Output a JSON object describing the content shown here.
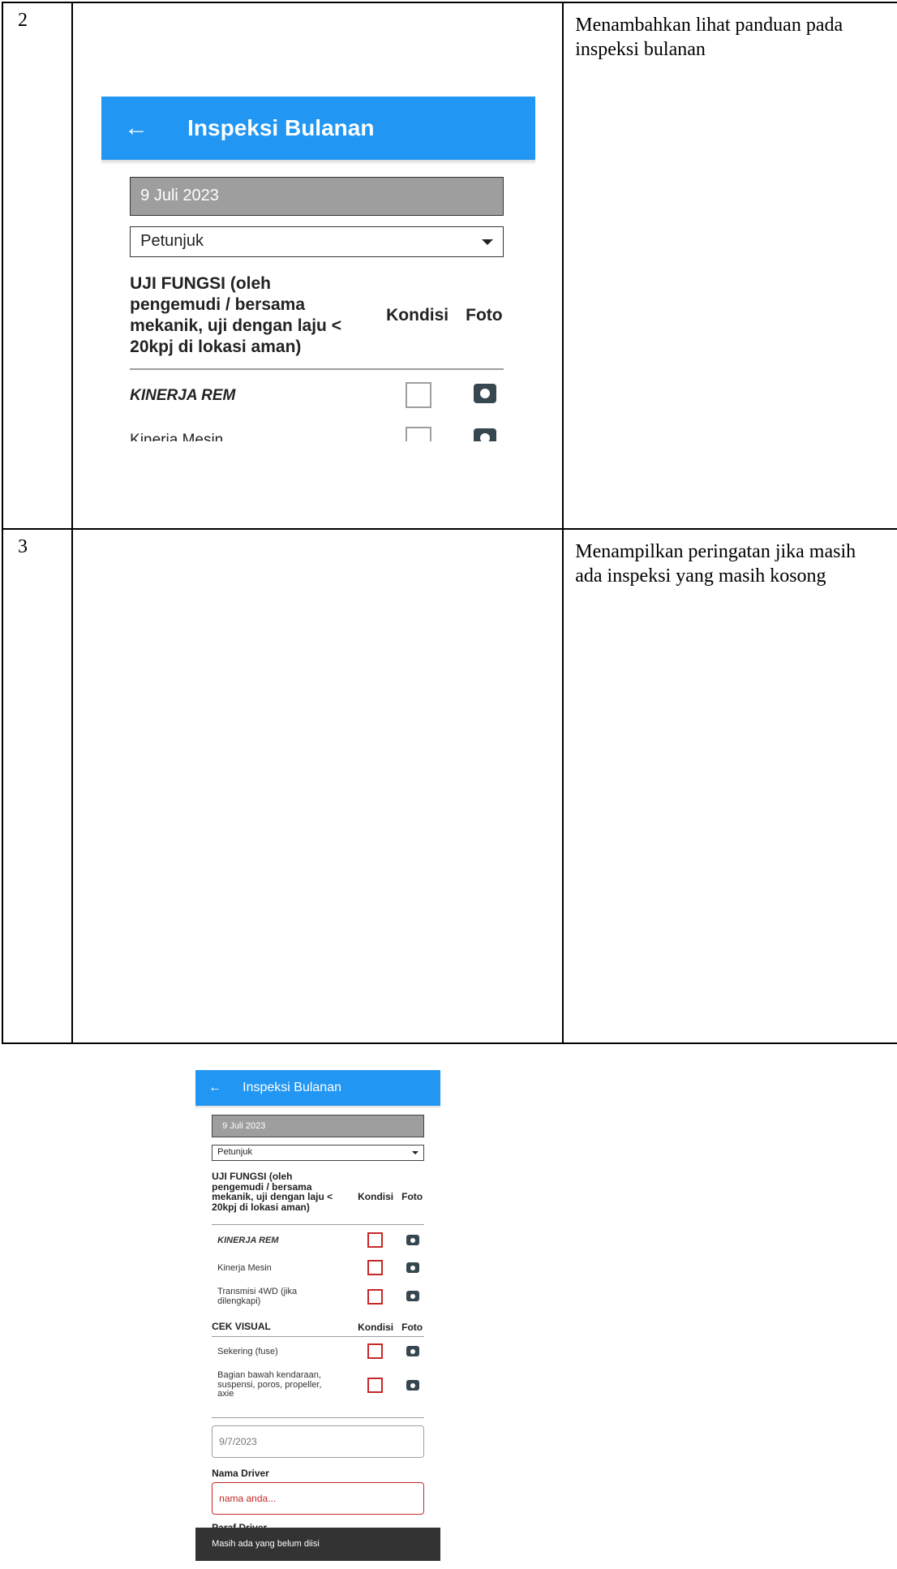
{
  "rows": [
    {
      "number": "2",
      "description": "Menambahkan lihat panduan pada inspeksi bulanan",
      "screen": {
        "appbar_title": "Inspeksi Bulanan",
        "date_value": "9 Juli 2023",
        "dropdown_value": "Petunjuk",
        "section_title": "UJI FUNGSI (oleh pengemudi / bersama mekanik, uji dengan laju < 20kpj di lokasi aman)",
        "col_condition": "Kondisi",
        "col_photo": "Foto",
        "items": [
          {
            "label": "KINERJA REM"
          },
          {
            "label": "Kinerja Mesin"
          }
        ]
      }
    },
    {
      "number": "3",
      "description": "Menampilkan peringatan jika masih ada inspeksi yang masih kosong",
      "screen": {
        "appbar_title": "Inspeksi Bulanan",
        "date_value": "9 Juli 2023",
        "dropdown_value": "Petunjuk",
        "sections": [
          {
            "title": "UJI FUNGSI (oleh pengemudi / bersama mekanik, uji dengan laju < 20kpj di lokasi aman)",
            "col_condition": "Kondisi",
            "col_photo": "Foto",
            "items": [
              {
                "label": "KINERJA REM"
              },
              {
                "label": "Kinerja Mesin"
              },
              {
                "label": "Transmisi 4WD (jika dilengkapi)"
              }
            ]
          },
          {
            "title": "CEK VISUAL",
            "col_condition": "Kondisi",
            "col_photo": "Foto",
            "items": [
              {
                "label": "Sekering (fuse)"
              },
              {
                "label": "Bagian bawah kendaraan, suspensi, poros, propeller, axie"
              }
            ]
          }
        ],
        "date_input_value": "9/7/2023",
        "driver_name_label": "Nama Driver",
        "driver_name_placeholder": "nama anda...",
        "next_field_label": "Paraf Driver",
        "snackbar_message": "Masih ada yang belum diisi"
      }
    }
  ],
  "colors": {
    "appbar": "#2196f3",
    "error": "#c62828",
    "snackbar": "#333333"
  }
}
